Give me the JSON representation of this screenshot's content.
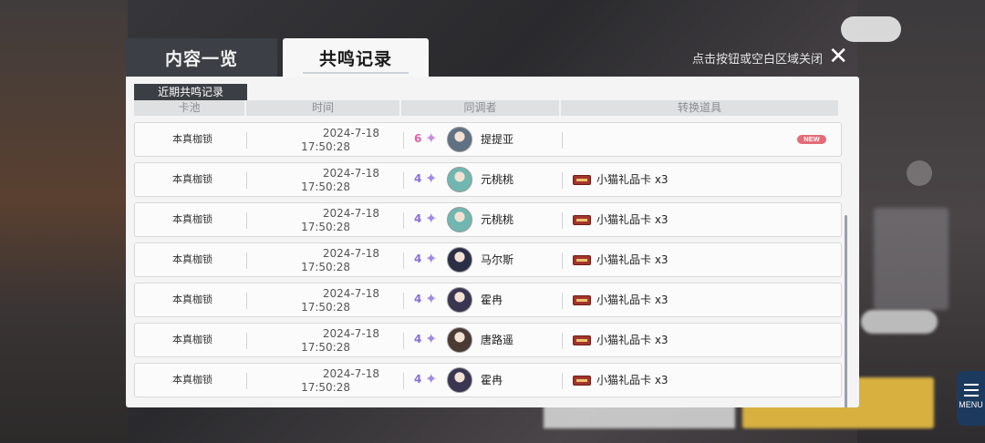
{
  "dialog": {
    "tabs": [
      {
        "label": "内容一览",
        "active": false
      },
      {
        "label": "共鸣记录",
        "active": true
      }
    ],
    "close_hint": "点击按钮或空白区域关闭",
    "close_icon": "✕",
    "section_label": "近期共鸣记录",
    "columns": [
      "卡池",
      "时间",
      "同调者",
      "转换道具"
    ],
    "rows": [
      {
        "pool": "本真枷锁",
        "date": "2024-7-18",
        "time": "17:50:28",
        "rarity": "6",
        "name": "提提亚",
        "item": "",
        "new": "NEW"
      },
      {
        "pool": "本真枷锁",
        "date": "2024-7-18",
        "time": "17:50:28",
        "rarity": "4",
        "name": "元桃桃",
        "item": "小猫礼品卡 x3",
        "new": ""
      },
      {
        "pool": "本真枷锁",
        "date": "2024-7-18",
        "time": "17:50:28",
        "rarity": "4",
        "name": "元桃桃",
        "item": "小猫礼品卡 x3",
        "new": ""
      },
      {
        "pool": "本真枷锁",
        "date": "2024-7-18",
        "time": "17:50:28",
        "rarity": "4",
        "name": "马尔斯",
        "item": "小猫礼品卡 x3",
        "new": ""
      },
      {
        "pool": "本真枷锁",
        "date": "2024-7-18",
        "time": "17:50:28",
        "rarity": "4",
        "name": "霍冉",
        "item": "小猫礼品卡 x3",
        "new": ""
      },
      {
        "pool": "本真枷锁",
        "date": "2024-7-18",
        "time": "17:50:28",
        "rarity": "4",
        "name": "唐路遥",
        "item": "小猫礼品卡 x3",
        "new": ""
      },
      {
        "pool": "本真枷锁",
        "date": "2024-7-18",
        "time": "17:50:28",
        "rarity": "4",
        "name": "霍冉",
        "item": "小猫礼品卡 x3",
        "new": ""
      }
    ]
  },
  "menu": {
    "label": "MENU"
  },
  "colors": {
    "rarity4": "#8a6fd6",
    "rarity6": "#e25fa6",
    "new_badge": "#e46b78",
    "avatars": [
      "#5f7182",
      "#6fb7b0",
      "#6fb7b0",
      "#2b2f45",
      "#3a3550",
      "#4a3a34",
      "#3a3550"
    ]
  }
}
